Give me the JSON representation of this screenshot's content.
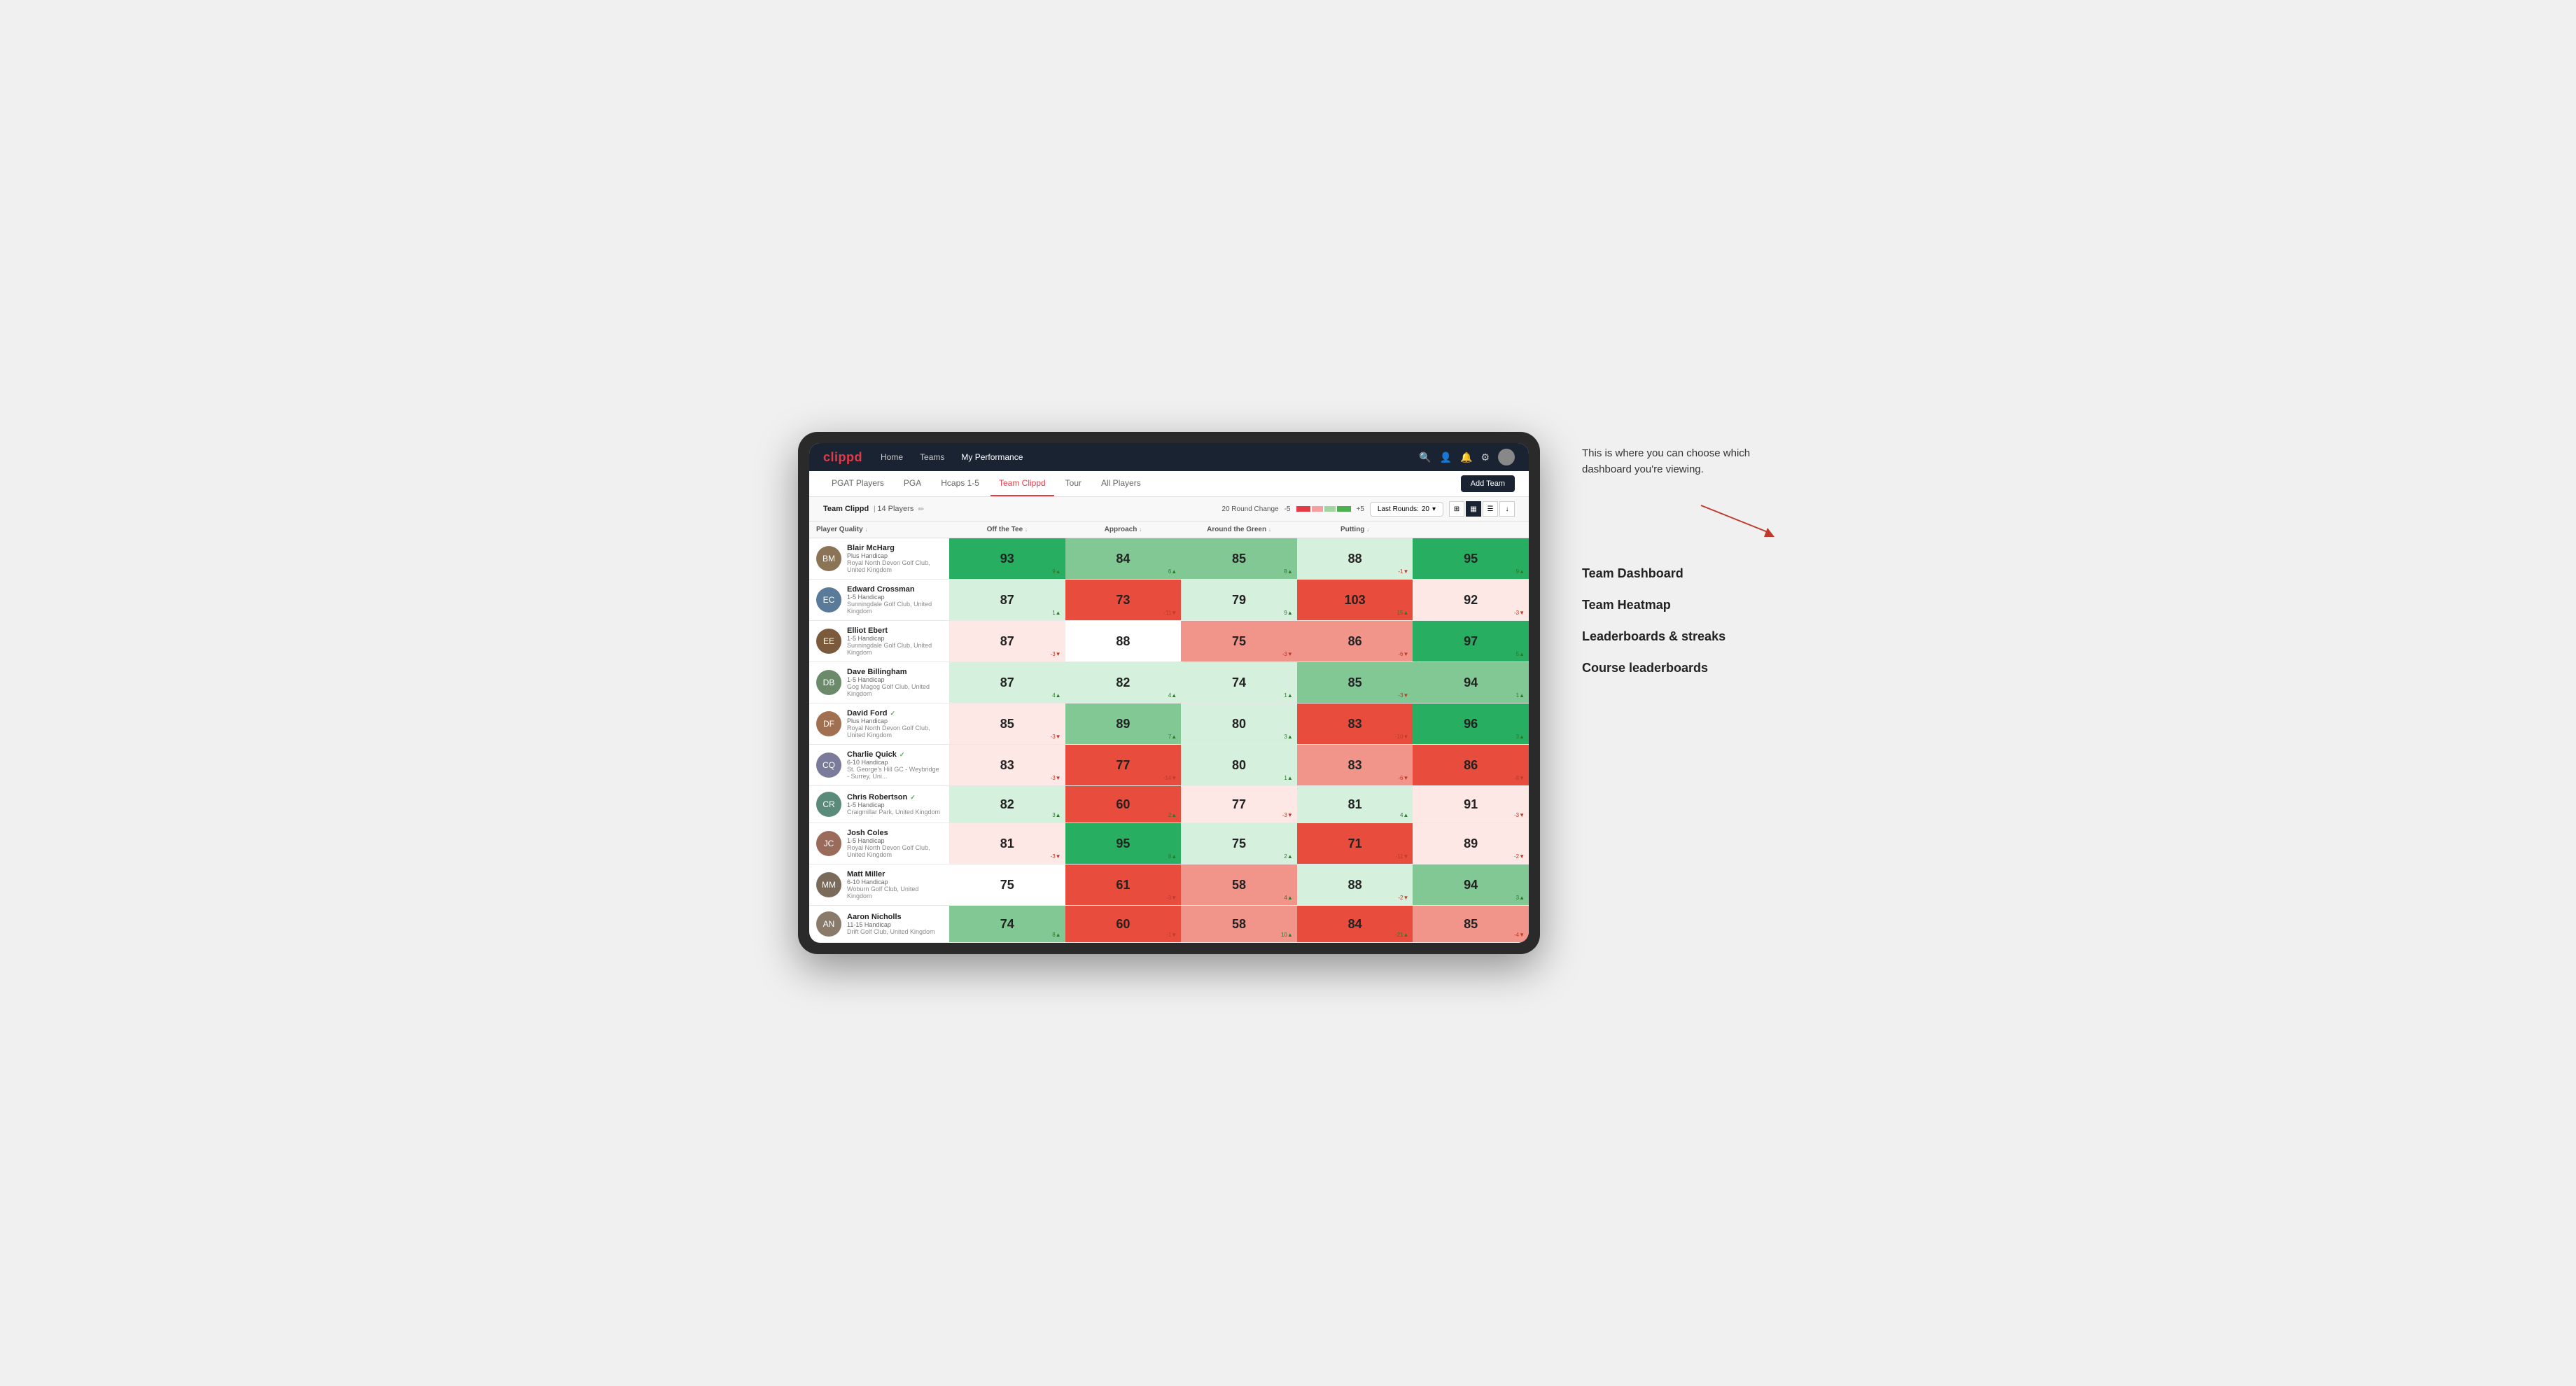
{
  "app": {
    "logo": "clippd",
    "nav_links": [
      "Home",
      "Teams",
      "My Performance"
    ],
    "sub_nav": [
      "PGAT Players",
      "PGA",
      "Hcaps 1-5",
      "Team Clippd",
      "Tour",
      "All Players"
    ],
    "active_sub_nav": "Team Clippd",
    "add_team_label": "Add Team"
  },
  "team_bar": {
    "team_name": "Team Clippd",
    "player_count": "14 Players",
    "round_change_label": "20 Round Change",
    "range_low": "-5",
    "range_high": "+5",
    "last_rounds_label": "Last Rounds:",
    "last_rounds_value": "20"
  },
  "table": {
    "columns": [
      "Player Quality ↓",
      "Off the Tee ↓",
      "Approach ↓",
      "Around the Green ↓",
      "Putting ↓"
    ],
    "rows": [
      {
        "name": "Blair McHarg",
        "hcap": "Plus Handicap",
        "club": "Royal North Devon Golf Club, United Kingdom",
        "avatar_color": "#8B7355",
        "stats": [
          {
            "value": "93",
            "change": "9▲",
            "dir": "up",
            "bg": "bg-green-dark"
          },
          {
            "value": "84",
            "change": "6▲",
            "dir": "up",
            "bg": "bg-green-med"
          },
          {
            "value": "85",
            "change": "8▲",
            "dir": "up",
            "bg": "bg-green-med"
          },
          {
            "value": "88",
            "change": "-1▼",
            "dir": "down",
            "bg": "bg-green-light"
          },
          {
            "value": "95",
            "change": "9▲",
            "dir": "up",
            "bg": "bg-green-dark"
          }
        ]
      },
      {
        "name": "Edward Crossman",
        "hcap": "1-5 Handicap",
        "club": "Sunningdale Golf Club, United Kingdom",
        "avatar_color": "#5a7a9a",
        "stats": [
          {
            "value": "87",
            "change": "1▲",
            "dir": "up",
            "bg": "bg-green-light"
          },
          {
            "value": "73",
            "change": "-11▼",
            "dir": "down",
            "bg": "bg-red-dark"
          },
          {
            "value": "79",
            "change": "9▲",
            "dir": "up",
            "bg": "bg-green-light"
          },
          {
            "value": "103",
            "change": "15▲",
            "dir": "up",
            "bg": "bg-red-dark"
          },
          {
            "value": "92",
            "change": "-3▼",
            "dir": "down",
            "bg": "bg-red-light"
          }
        ]
      },
      {
        "name": "Elliot Ebert",
        "hcap": "1-5 Handicap",
        "club": "Sunningdale Golf Club, United Kingdom",
        "avatar_color": "#7a5a3a",
        "stats": [
          {
            "value": "87",
            "change": "-3▼",
            "dir": "down",
            "bg": "bg-red-light"
          },
          {
            "value": "88",
            "change": "",
            "dir": "neutral",
            "bg": "bg-white"
          },
          {
            "value": "75",
            "change": "-3▼",
            "dir": "down",
            "bg": "bg-red-med"
          },
          {
            "value": "86",
            "change": "-6▼",
            "dir": "down",
            "bg": "bg-red-med"
          },
          {
            "value": "97",
            "change": "5▲",
            "dir": "up",
            "bg": "bg-green-dark"
          }
        ]
      },
      {
        "name": "Dave Billingham",
        "hcap": "1-5 Handicap",
        "club": "Gog Magog Golf Club, United Kingdom",
        "avatar_color": "#6a8a6a",
        "stats": [
          {
            "value": "87",
            "change": "4▲",
            "dir": "up",
            "bg": "bg-green-light"
          },
          {
            "value": "82",
            "change": "4▲",
            "dir": "up",
            "bg": "bg-green-light"
          },
          {
            "value": "74",
            "change": "1▲",
            "dir": "up",
            "bg": "bg-green-light"
          },
          {
            "value": "85",
            "change": "-3▼",
            "dir": "down",
            "bg": "bg-green-med"
          },
          {
            "value": "94",
            "change": "1▲",
            "dir": "up",
            "bg": "bg-green-med"
          }
        ]
      },
      {
        "name": "David Ford",
        "hcap": "Plus Handicap",
        "club": "Royal North Devon Golf Club, United Kingdom",
        "avatar_color": "#a07050",
        "verified": true,
        "stats": [
          {
            "value": "85",
            "change": "-3▼",
            "dir": "down",
            "bg": "bg-red-light"
          },
          {
            "value": "89",
            "change": "7▲",
            "dir": "up",
            "bg": "bg-green-med"
          },
          {
            "value": "80",
            "change": "3▲",
            "dir": "up",
            "bg": "bg-green-light"
          },
          {
            "value": "83",
            "change": "-10▼",
            "dir": "down",
            "bg": "bg-red-dark"
          },
          {
            "value": "96",
            "change": "3▲",
            "dir": "up",
            "bg": "bg-green-dark"
          }
        ]
      },
      {
        "name": "Charlie Quick",
        "hcap": "6-10 Handicap",
        "club": "St. George's Hill GC - Weybridge - Surrey, Uni...",
        "avatar_color": "#7a7a9a",
        "verified": true,
        "stats": [
          {
            "value": "83",
            "change": "-3▼",
            "dir": "down",
            "bg": "bg-red-light"
          },
          {
            "value": "77",
            "change": "-14▼",
            "dir": "down",
            "bg": "bg-red-dark"
          },
          {
            "value": "80",
            "change": "1▲",
            "dir": "up",
            "bg": "bg-green-light"
          },
          {
            "value": "83",
            "change": "-6▼",
            "dir": "down",
            "bg": "bg-red-med"
          },
          {
            "value": "86",
            "change": "-8▼",
            "dir": "down",
            "bg": "bg-red-dark"
          }
        ]
      },
      {
        "name": "Chris Robertson",
        "hcap": "1-5 Handicap",
        "club": "Craigmillar Park, United Kingdom",
        "avatar_color": "#5a8a7a",
        "verified": true,
        "stats": [
          {
            "value": "82",
            "change": "3▲",
            "dir": "up",
            "bg": "bg-green-light"
          },
          {
            "value": "60",
            "change": "2▲",
            "dir": "up",
            "bg": "bg-red-dark"
          },
          {
            "value": "77",
            "change": "-3▼",
            "dir": "down",
            "bg": "bg-red-light"
          },
          {
            "value": "81",
            "change": "4▲",
            "dir": "up",
            "bg": "bg-green-light"
          },
          {
            "value": "91",
            "change": "-3▼",
            "dir": "down",
            "bg": "bg-red-light"
          }
        ]
      },
      {
        "name": "Josh Coles",
        "hcap": "1-5 Handicap",
        "club": "Royal North Devon Golf Club, United Kingdom",
        "avatar_color": "#9a6a5a",
        "stats": [
          {
            "value": "81",
            "change": "-3▼",
            "dir": "down",
            "bg": "bg-red-light"
          },
          {
            "value": "95",
            "change": "8▲",
            "dir": "up",
            "bg": "bg-green-dark"
          },
          {
            "value": "75",
            "change": "2▲",
            "dir": "up",
            "bg": "bg-green-light"
          },
          {
            "value": "71",
            "change": "-11▼",
            "dir": "down",
            "bg": "bg-red-dark"
          },
          {
            "value": "89",
            "change": "-2▼",
            "dir": "down",
            "bg": "bg-red-light"
          }
        ]
      },
      {
        "name": "Matt Miller",
        "hcap": "6-10 Handicap",
        "club": "Woburn Golf Club, United Kingdom",
        "avatar_color": "#7a6a5a",
        "stats": [
          {
            "value": "75",
            "change": "",
            "dir": "neutral",
            "bg": "bg-white"
          },
          {
            "value": "61",
            "change": "-3▼",
            "dir": "down",
            "bg": "bg-red-dark"
          },
          {
            "value": "58",
            "change": "4▲",
            "dir": "up",
            "bg": "bg-red-med"
          },
          {
            "value": "88",
            "change": "-2▼",
            "dir": "down",
            "bg": "bg-green-light"
          },
          {
            "value": "94",
            "change": "3▲",
            "dir": "up",
            "bg": "bg-green-med"
          }
        ]
      },
      {
        "name": "Aaron Nicholls",
        "hcap": "11-15 Handicap",
        "club": "Drift Golf Club, United Kingdom",
        "avatar_color": "#8a7a6a",
        "stats": [
          {
            "value": "74",
            "change": "8▲",
            "dir": "up",
            "bg": "bg-green-med"
          },
          {
            "value": "60",
            "change": "-1▼",
            "dir": "down",
            "bg": "bg-red-dark"
          },
          {
            "value": "58",
            "change": "10▲",
            "dir": "up",
            "bg": "bg-red-med"
          },
          {
            "value": "84",
            "change": "-21▲",
            "dir": "up",
            "bg": "bg-red-dark"
          },
          {
            "value": "85",
            "change": "-4▼",
            "dir": "down",
            "bg": "bg-red-med"
          }
        ]
      }
    ]
  },
  "annotation": {
    "intro_text": "This is where you can choose which dashboard you're viewing.",
    "menu_items": [
      "Team Dashboard",
      "Team Heatmap",
      "Leaderboards & streaks",
      "Course leaderboards"
    ]
  }
}
